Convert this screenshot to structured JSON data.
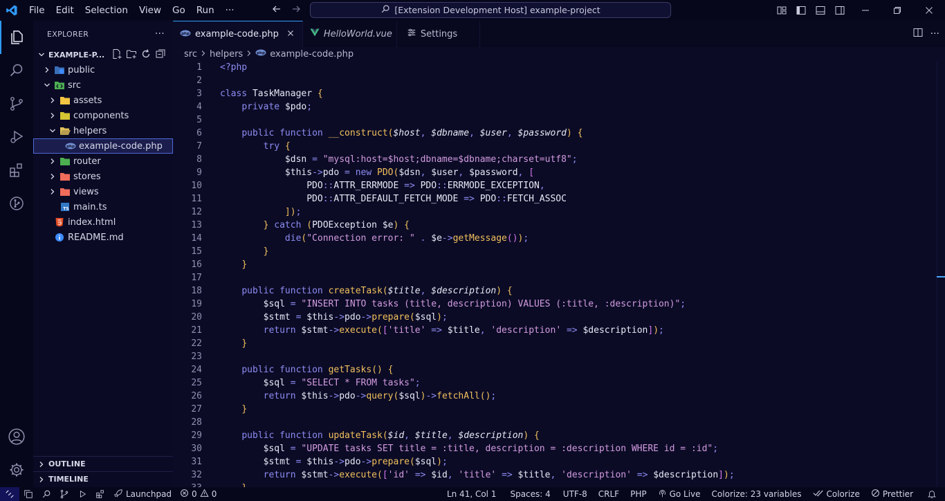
{
  "titlebar": {
    "menus": [
      "File",
      "Edit",
      "Selection",
      "View",
      "Go",
      "Run"
    ],
    "more": "···",
    "command_center": "[Extension Development Host] example-project"
  },
  "activity_bar": [
    "explorer-icon",
    "search-icon",
    "source-control-icon",
    "run-debug-icon",
    "extensions-icon",
    "git-graph-icon",
    "account-icon",
    "settings-gear-icon"
  ],
  "sidebar": {
    "title": "EXPLORER",
    "more": "···",
    "project": "EXAMPLE-P...",
    "tree": [
      {
        "label": "public",
        "indent": 1,
        "chevron": "right",
        "icon": "globe-folder",
        "color": "#3d8bfd"
      },
      {
        "label": "src",
        "indent": 1,
        "chevron": "down",
        "icon": "code-folder",
        "color": "#4caf50"
      },
      {
        "label": "assets",
        "indent": 2,
        "chevron": "right",
        "icon": "folder",
        "color": "#f4c542"
      },
      {
        "label": "components",
        "indent": 2,
        "chevron": "right",
        "icon": "folder",
        "color": "#d4c534"
      },
      {
        "label": "helpers",
        "indent": 2,
        "chevron": "down",
        "icon": "folder-open",
        "color": "#e3c15a"
      },
      {
        "label": "example-code.php",
        "indent": 3,
        "chevron": "none",
        "icon": "php",
        "color": "#6f8ccf",
        "selected": true
      },
      {
        "label": "router",
        "indent": 2,
        "chevron": "right",
        "icon": "folder",
        "color": "#4caf50"
      },
      {
        "label": "stores",
        "indent": 2,
        "chevron": "right",
        "icon": "folder",
        "color": "#ef6c5a"
      },
      {
        "label": "views",
        "indent": 2,
        "chevron": "right",
        "icon": "folder",
        "color": "#ef6c5a"
      },
      {
        "label": "main.ts",
        "indent": 2,
        "chevron": "none",
        "icon": "ts",
        "color": "#3178c6"
      },
      {
        "label": "index.html",
        "indent": 1,
        "chevron": "none",
        "icon": "html",
        "color": "#e44d26"
      },
      {
        "label": "README.md",
        "indent": 1,
        "chevron": "none",
        "icon": "info",
        "color": "#3d8bfd"
      }
    ],
    "outline": "OUTLINE",
    "timeline": "TIMELINE"
  },
  "tabs": [
    {
      "label": "example-code.php",
      "active": true,
      "icon": "php"
    },
    {
      "label": "HelloWorld.vue",
      "active": false,
      "icon": "vue",
      "italic": true
    },
    {
      "label": "Settings",
      "active": false,
      "icon": "settings"
    }
  ],
  "breadcrumb": [
    "src",
    "helpers",
    "example-code.php"
  ],
  "code_lines": [
    "<?php",
    "",
    "class TaskManager {",
    "    private $pdo;",
    "",
    "    public function __construct($host, $dbname, $user, $password) {",
    "        try {",
    "            $dsn = \"mysql:host=$host;dbname=$dbname;charset=utf8\";",
    "            $this->pdo = new PDO($dsn, $user, $password, [",
    "                PDO::ATTR_ERRMODE => PDO::ERRMODE_EXCEPTION,",
    "                PDO::ATTR_DEFAULT_FETCH_MODE => PDO::FETCH_ASSOC",
    "            ]);",
    "        } catch (PDOException $e) {",
    "            die(\"Connection error: \" . $e->getMessage());",
    "        }",
    "    }",
    "",
    "    public function createTask($title, $description) {",
    "        $sql = \"INSERT INTO tasks (title, description) VALUES (:title, :description)\";",
    "        $stmt = $this->pdo->prepare($sql);",
    "        return $stmt->execute(['title' => $title, 'description' => $description]);",
    "    }",
    "",
    "    public function getTasks() {",
    "        $sql = \"SELECT * FROM tasks\";",
    "        return $this->pdo->query($sql)->fetchAll();",
    "    }",
    "",
    "    public function updateTask($id, $title, $description) {",
    "        $sql = \"UPDATE tasks SET title = :title, description = :description WHERE id = :id\";",
    "        $stmt = $this->pdo->prepare($sql);",
    "        return $stmt->execute(['id' => $id, 'title' => $title, 'description' => $description]);",
    "    }"
  ],
  "statusbar": {
    "launchpad": "Launchpad",
    "errors": "0",
    "warnings": "0",
    "position": "Ln 41, Col 1",
    "spaces": "Spaces: 4",
    "encoding": "UTF-8",
    "eol": "CRLF",
    "language": "PHP",
    "golive": "Go Live",
    "colorize_vars": "Colorize: 23 variables",
    "colorize": "Colorize",
    "prettier": "Prettier"
  }
}
